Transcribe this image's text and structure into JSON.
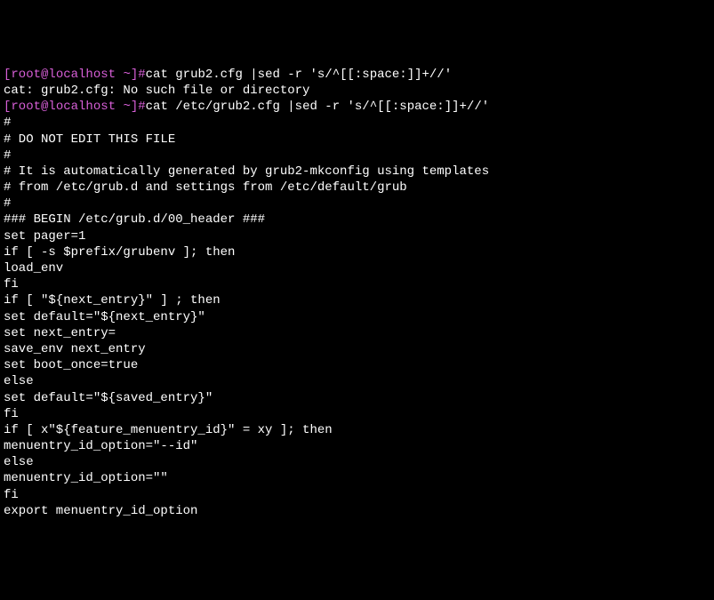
{
  "prompt": {
    "open_bracket": "[",
    "user": "root@localhost",
    "separator": " ",
    "path": "~",
    "close_bracket": "]",
    "symbol": "#"
  },
  "cmd1": "cat grub2.cfg |sed -r 's/^[[:space:]]+//'",
  "err1": "cat: grub2.cfg: No such file or directory",
  "cmd2": "cat /etc/grub2.cfg |sed -r 's/^[[:space:]]+//'",
  "lines": {
    "l0": "#",
    "l1": "# DO NOT EDIT THIS FILE",
    "l2": "#",
    "l3": "# It is automatically generated by grub2-mkconfig using templates",
    "l4": "# from /etc/grub.d and settings from /etc/default/grub",
    "l5": "#",
    "l6": "",
    "l7": "### BEGIN /etc/grub.d/00_header ###",
    "l8": "set pager=1",
    "l9": "",
    "l10": "if [ -s $prefix/grubenv ]; then",
    "l11": "load_env",
    "l12": "fi",
    "l13": "if [ \"${next_entry}\" ] ; then",
    "l14": "set default=\"${next_entry}\"",
    "l15": "set next_entry=",
    "l16": "save_env next_entry",
    "l17": "set boot_once=true",
    "l18": "else",
    "l19": "set default=\"${saved_entry}\"",
    "l20": "fi",
    "l21": "",
    "l22": "if [ x\"${feature_menuentry_id}\" = xy ]; then",
    "l23": "menuentry_id_option=\"--id\"",
    "l24": "else",
    "l25": "menuentry_id_option=\"\"",
    "l26": "fi",
    "l27": "",
    "l28": "export menuentry_id_option"
  }
}
